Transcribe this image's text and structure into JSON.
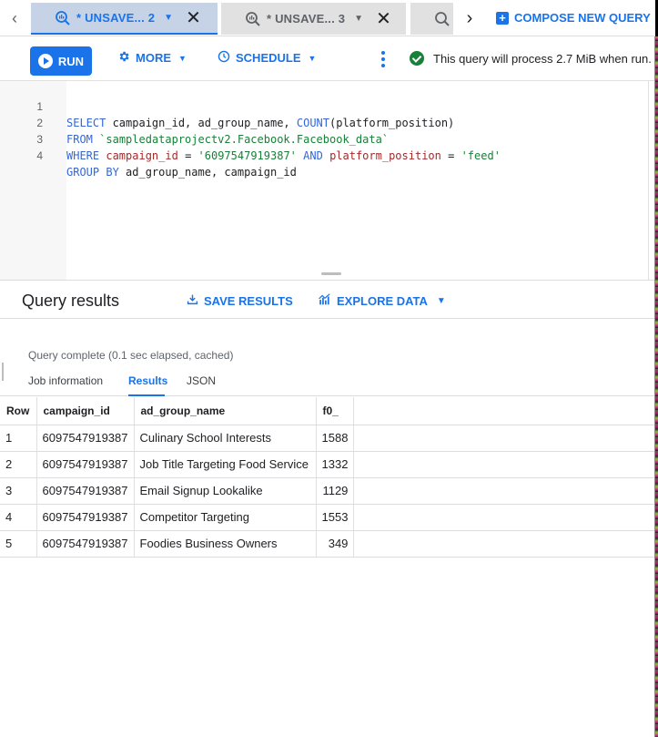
{
  "tabs": [
    {
      "label": "* UNSAVE... 2",
      "active": true
    },
    {
      "label": "* UNSAVE... 3",
      "active": false
    }
  ],
  "compose_label": "COMPOSE NEW QUERY",
  "toolbar": {
    "run_label": "RUN",
    "more_label": "MORE",
    "schedule_label": "SCHEDULE",
    "status_text": "This query will process 2.7 MiB when run."
  },
  "editor": {
    "line_numbers": [
      "1",
      "2",
      "3",
      "4"
    ],
    "lines": [
      "SELECT campaign_id, ad_group_name, COUNT(platform_position)",
      "FROM `sampledataprojectv2.Facebook.Facebook_data`",
      "WHERE campaign_id = '6097547919387' AND platform_position = 'feed'",
      "GROUP BY ad_group_name, campaign_id"
    ]
  },
  "results": {
    "title": "Query results",
    "save_label": "SAVE RESULTS",
    "explore_label": "EXPLORE DATA",
    "complete_text": "Query complete (0.1 sec elapsed, cached)",
    "subtabs": [
      "Job information",
      "Results",
      "JSON"
    ],
    "active_subtab": "Results"
  },
  "table": {
    "headers": [
      "Row",
      "campaign_id",
      "ad_group_name",
      "f0_"
    ],
    "rows": [
      [
        "1",
        "6097547919387",
        "Culinary School Interests",
        "1588"
      ],
      [
        "2",
        "6097547919387",
        "Job Title Targeting Food Service",
        "1332"
      ],
      [
        "3",
        "6097547919387",
        "Email Signup Lookalike",
        "1129"
      ],
      [
        "4",
        "6097547919387",
        "Competitor Targeting",
        "1553"
      ],
      [
        "5",
        "6097547919387",
        "Foodies Business Owners",
        "349"
      ]
    ]
  },
  "colors": {
    "accent": "#1a73e8",
    "success": "#188038",
    "active_tab_bg": "#c6d3e6"
  }
}
